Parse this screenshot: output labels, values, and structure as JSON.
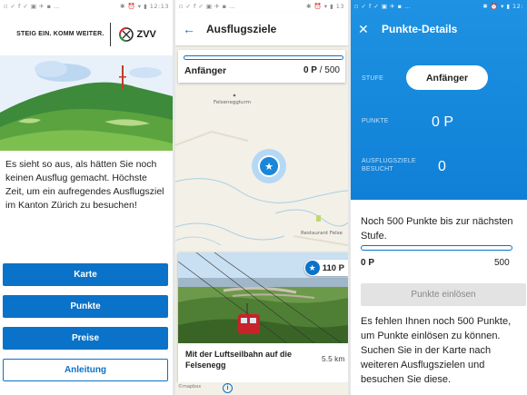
{
  "phone1": {
    "status_left": "▫ ✓ f ✓ ▣ ✈ ▪ …",
    "status_right": "✱ ⏰ ▾ ▮ 12:13",
    "slogan": "STEIG EIN. KOMM WEITER.",
    "logo_text": "ZVV",
    "intro_text": "Es sieht so aus, als hätten Sie noch keinen Ausflug gemacht. Höchste Zeit, um ein aufregendes Ausflugsziel im Kanton Zürich zu besuchen!",
    "buttons": [
      "Karte",
      "Punkte",
      "Preise",
      "Anleitung"
    ]
  },
  "phone2": {
    "status_left": "▫ ✓ f ✓ ▣ ✈ ▪ …",
    "status_right": "✱ ⏰ ▾ ▮ 13",
    "title": "Ausflugsziele",
    "level": "Anfänger",
    "points_current": "0 P",
    "points_max": "/ 500",
    "map_label_1": "Felseneggturm",
    "map_label_2": "Restaurant Felse",
    "poi_points": "110 P",
    "poi_name": "Mit der Luftseilbahn auf die Felsenegg",
    "poi_distance": "5.5 km",
    "attribution": "©mapbox",
    "info_icon_text": "i"
  },
  "phone3": {
    "status_left": "▫ ✓ f ✓ ▣ ✈ ▪ …",
    "status_right": "✱ ⏰ ▾ ▮ 12:",
    "title": "Punkte-Details",
    "stufe_label": "STUFE",
    "stufe_value": "Anfänger",
    "punkte_label": "PUNKTE",
    "punkte_value": "0 P",
    "besucht_label": "AUSFLUGSZIELE BESUCHT",
    "besucht_value": "0",
    "next_level_text": "Noch 500 Punkte bis zur nächsten Stufe.",
    "progress_current": "0 P",
    "progress_max": "500",
    "progress_fraction": 0,
    "redeem_label": "Punkte einlösen",
    "missing_text": "Es fehlen Ihnen noch 500 Punkte, um Punkte einlösen zu können. Suchen Sie in der Karte nach weiteren Ausflugszielen und besuchen Sie diese."
  },
  "colors": {
    "accent": "#0a72c8",
    "hero": "#1789de"
  }
}
